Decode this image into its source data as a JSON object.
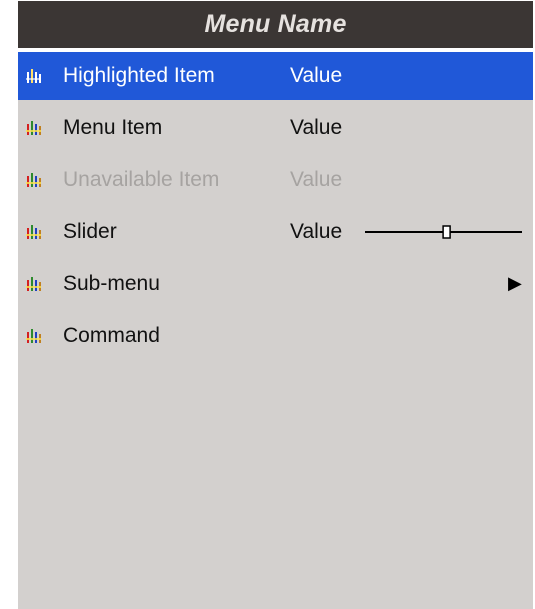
{
  "menu": {
    "title": "Menu Name",
    "items": [
      {
        "label": "Highlighted Item",
        "value": "Value",
        "state": "highlighted"
      },
      {
        "label": "Menu Item",
        "value": "Value",
        "state": "normal"
      },
      {
        "label": "Unavailable Item",
        "value": "Value",
        "state": "disabled"
      },
      {
        "label": "Slider",
        "value": "Value",
        "state": "normal",
        "slider_fraction": 0.52
      },
      {
        "label": "Sub-menu",
        "state": "normal",
        "submenu_arrow": "▶"
      },
      {
        "label": "Command",
        "state": "normal"
      }
    ]
  },
  "icons": {
    "item_icon": "palette-bars-icon",
    "submenu_icon": "right-triangle-arrow-icon"
  },
  "colors": {
    "title_bar": "#3b3634",
    "menu_background": "#d3d0ce",
    "highlight": "#2058d8",
    "disabled_text": "#a6a3a1"
  }
}
